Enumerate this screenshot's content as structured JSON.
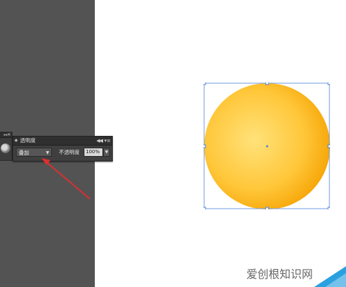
{
  "transparency_panel": {
    "title": "透明度",
    "blend_mode": "叠加",
    "opacity_label": "不透明度",
    "opacity_value": "100%",
    "collapse_icon": "◀◀",
    "menu_icon": "▾≡"
  },
  "mini_panel": {
    "header_icon": "▸▸",
    "close_icon": "×"
  },
  "artwork": {
    "fill_colors": [
      "#ffd54a",
      "#f7a800"
    ],
    "selection_color": "#4a7fd6"
  },
  "annotation": {
    "arrow_color": "#d93030"
  },
  "watermark": {
    "text": "爱创根知识网"
  }
}
